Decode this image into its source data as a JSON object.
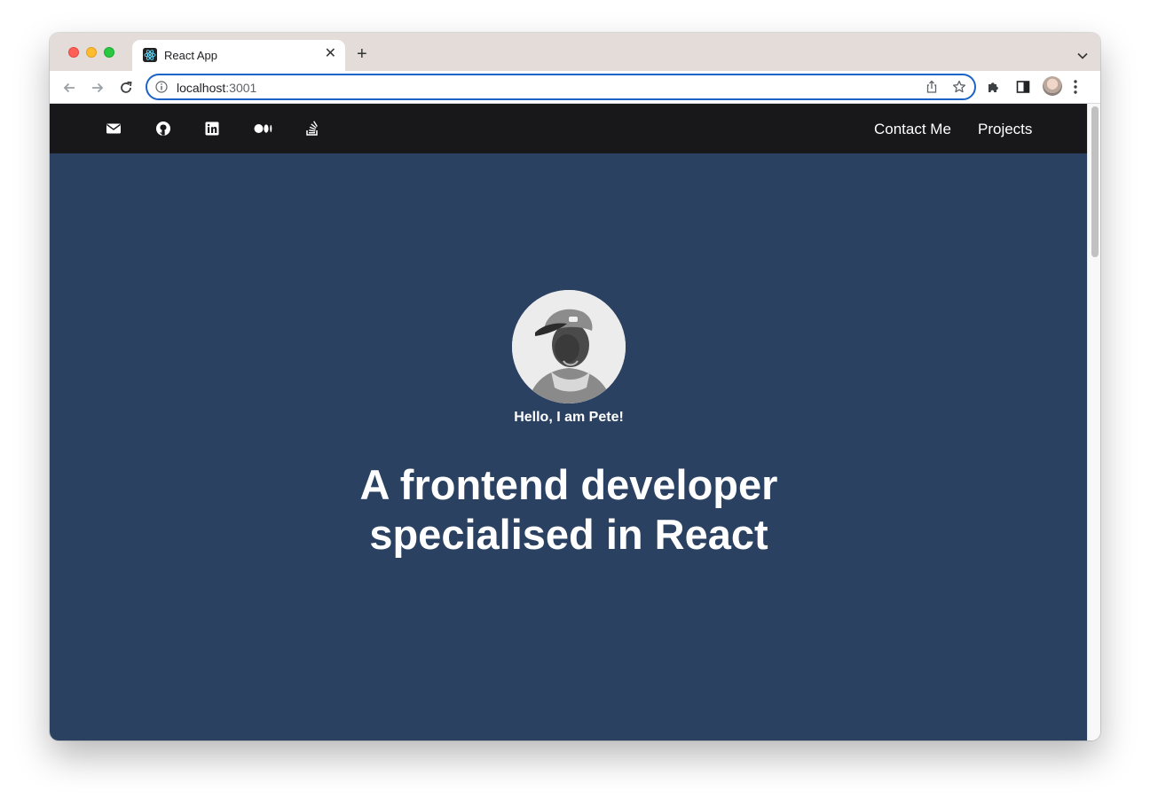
{
  "browser": {
    "tab_title": "React App",
    "new_tab_label": "+",
    "close_label": "✕",
    "url_host": "localhost",
    "url_port": ":3001"
  },
  "site": {
    "social_icons": [
      "envelope-icon",
      "github-icon",
      "linkedin-icon",
      "medium-icon",
      "stack-overflow-icon"
    ],
    "nav": {
      "contact": "Contact Me",
      "projects": "Projects"
    },
    "hero": {
      "greeting": "Hello, I am Pete!",
      "headline_line1": "A frontend developer",
      "headline_line2": "specialised in React"
    }
  },
  "colors": {
    "header_bg": "#18181b",
    "hero_bg": "#2b4162",
    "omnibox_focus": "#1a63c7"
  }
}
